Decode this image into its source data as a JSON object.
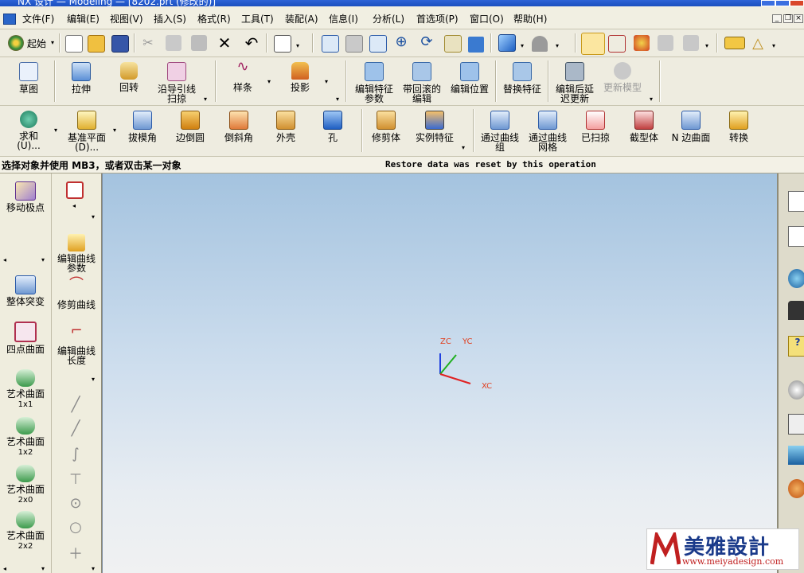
{
  "title": {
    "text": "NX 设计 — Modeling — [8202.prt (修改的)]"
  },
  "menu": {
    "items": [
      "文件(F)",
      "编辑(E)",
      "视图(V)",
      "插入(S)",
      "格式(R)",
      "工具(T)",
      "装配(A)",
      "信息(I)",
      "分析(L)",
      "首选项(P)",
      "窗口(O)",
      "帮助(H)"
    ],
    "window_controls": [
      "_",
      "❐",
      "×"
    ]
  },
  "standard_toolbar": {
    "start_label": "起始"
  },
  "toolbar1": {
    "items": [
      "草图",
      "拉伸",
      "回转",
      "沿导引线\n扫掠",
      "样条",
      "投影",
      "编辑特征\n参数",
      "带回滚的\n编辑",
      "编辑位置",
      "替换特征",
      "编辑后延\n迟更新",
      "更新模型"
    ]
  },
  "toolbar2": {
    "items": [
      "求和\n(U)...",
      "基准平面\n(D)...",
      "拔模角",
      "边倒圆",
      "倒斜角",
      "外壳",
      "孔",
      "修剪体",
      "实例特征",
      "通过曲线\n组",
      "通过曲线\n网格",
      "已扫掠",
      "截型体",
      "N 边曲面",
      "转换"
    ]
  },
  "status": {
    "prompt": "选择对象并使用 MB3，或者双击某一对象",
    "message": "Restore data was reset by this operation"
  },
  "left_panel1": {
    "items": [
      {
        "label": "移动极点",
        "sub": ""
      },
      {
        "label": "整体突变",
        "sub": ""
      },
      {
        "label": "四点曲面",
        "sub": ""
      },
      {
        "label": "艺术曲面",
        "sub": "1x1"
      },
      {
        "label": "艺术曲面",
        "sub": "1x2"
      },
      {
        "label": "艺术曲面",
        "sub": "2x0"
      },
      {
        "label": "艺术曲面",
        "sub": "2x2"
      }
    ]
  },
  "left_panel2": {
    "items": [
      "编辑曲线\n参数",
      "修剪曲线",
      "编辑曲线\n长度"
    ]
  },
  "axes": {
    "zc": "ZC",
    "yc": "YC",
    "xc": "XC"
  },
  "watermark": {
    "brand": "美雅設計",
    "url": "www.meiyadesign.com"
  },
  "colors": {
    "accent": "#2d63d6",
    "viewport_top": "#a4c3df",
    "viewport_bottom": "#f0f1f2",
    "axis_x": "#e02020",
    "axis_y": "#20b020",
    "axis_z": "#2040e0"
  }
}
